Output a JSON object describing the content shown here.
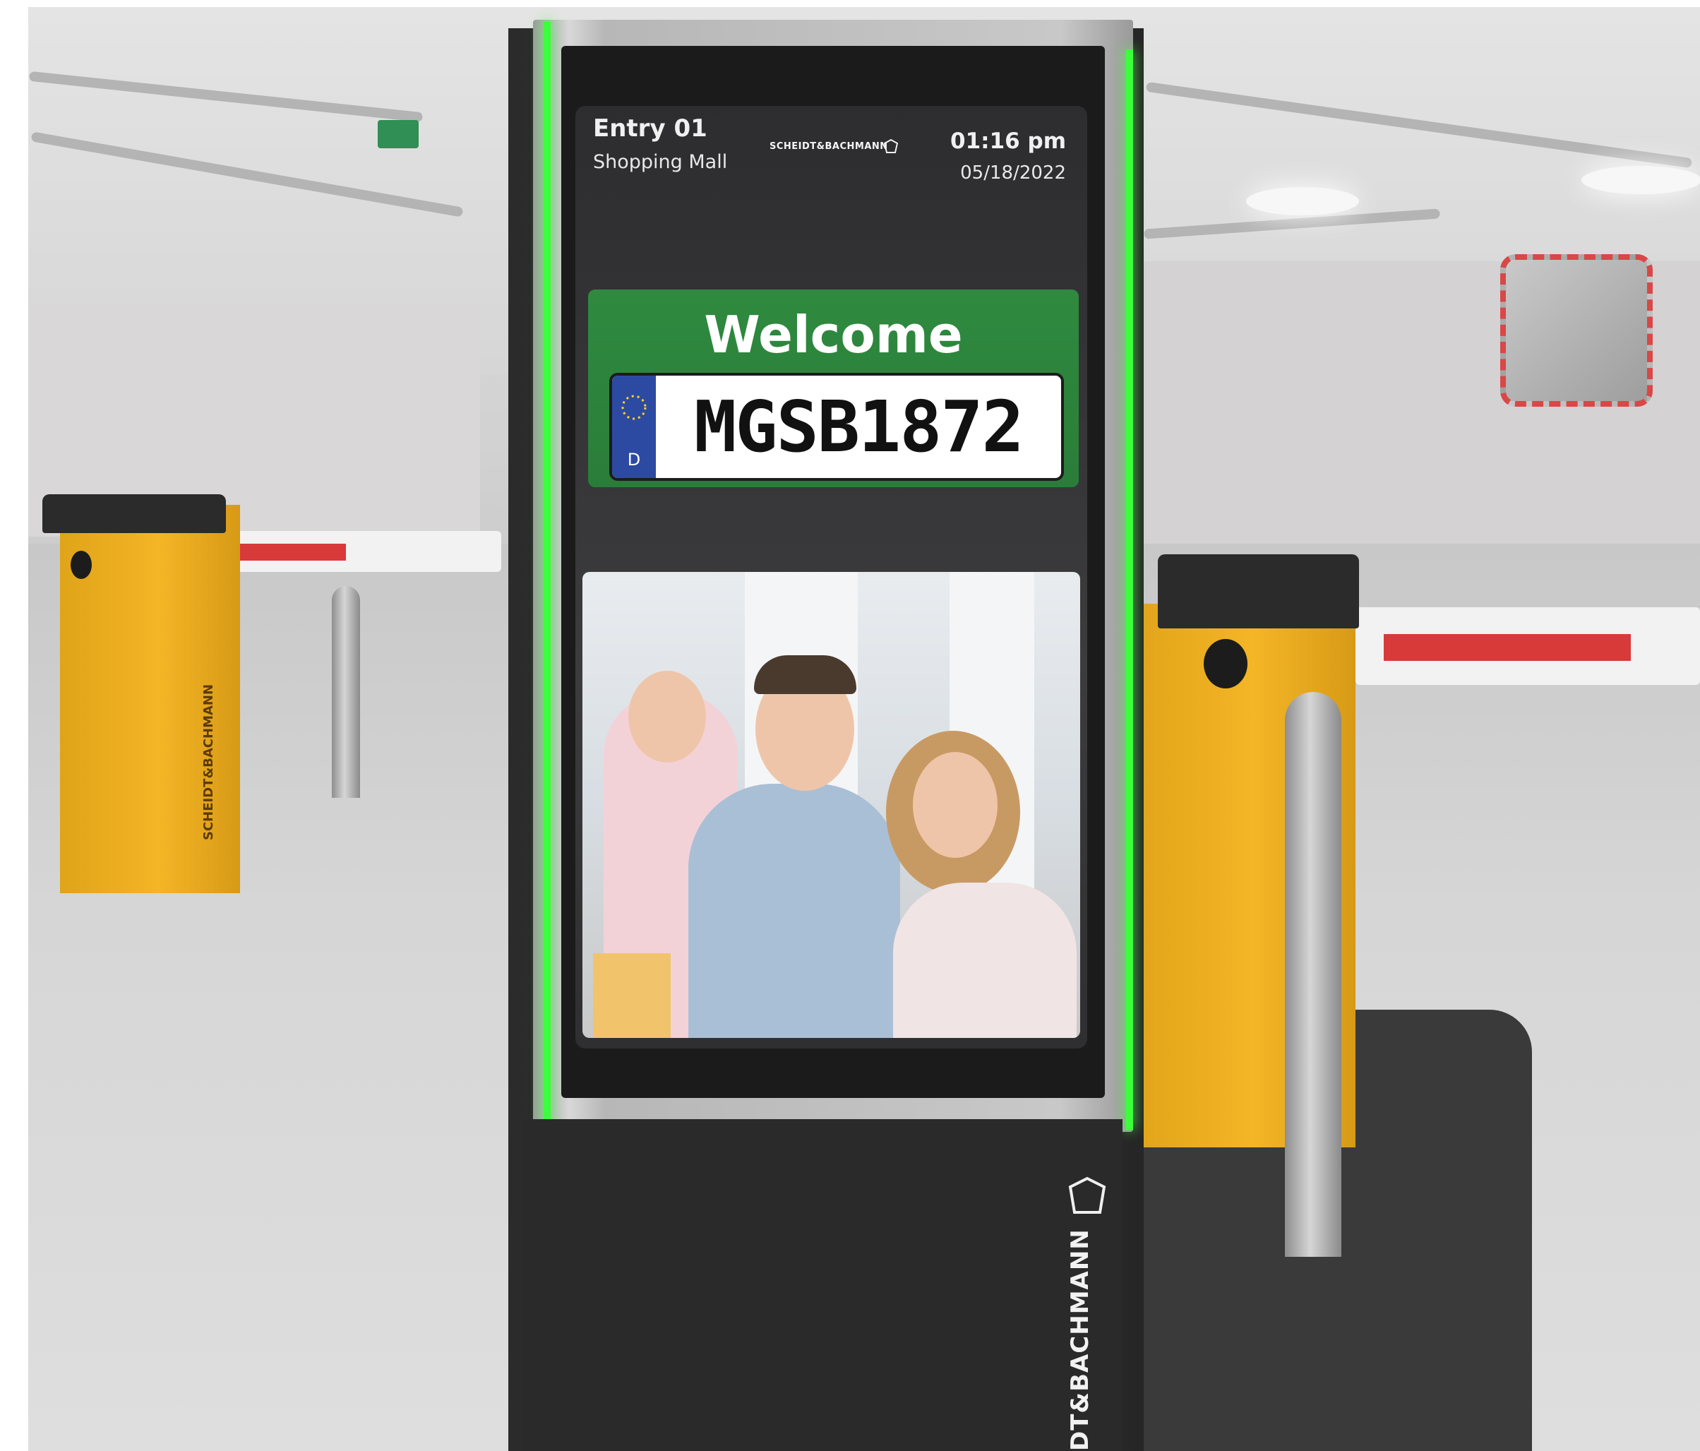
{
  "screen": {
    "entry_title": "Entry 01",
    "entry_location": "Shopping Mall",
    "brand_logo": "SCHEIDT&BACHMANN",
    "time": "01:16 pm",
    "date": "05/18/2022",
    "welcome": "Welcome",
    "plate": {
      "country_code": "D",
      "number": "MGSB1872"
    }
  },
  "kiosk": {
    "vertical_brand": "DT&BACHMANN",
    "led_color": "#3cff3c"
  },
  "barriers": {
    "left_label": "SCHEIDT&BACHMANN"
  },
  "colors": {
    "welcome_green": "#2f8a3f",
    "eu_blue": "#2d4aa3",
    "barrier_yellow": "#f4b526",
    "arm_red": "#d83a3a"
  }
}
